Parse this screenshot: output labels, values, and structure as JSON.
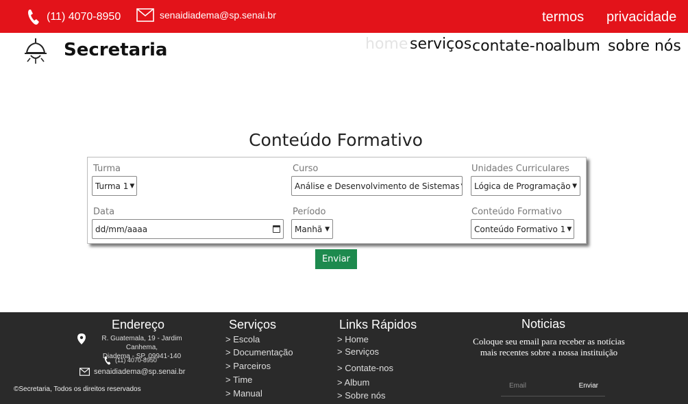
{
  "topbar": {
    "phone": "(11) 4070-8950",
    "email": "senaidiadema@sp.senai.br",
    "termos": "termos",
    "privacidade": "privacidade"
  },
  "brand": {
    "name": "Secretaria"
  },
  "nav": {
    "home": "home",
    "servicos": "serviços",
    "contate": "contate-no",
    "album": "album",
    "sobre": "sobre nós"
  },
  "form": {
    "title": "Conteúdo Formativo",
    "turma": {
      "label": "Turma",
      "value": "Turma 1"
    },
    "curso": {
      "label": "Curso",
      "value": "Análise e Desenvolvimento de Sistemas"
    },
    "uc": {
      "label": "Unidades Curriculares",
      "value": "Lógica de Programação"
    },
    "data": {
      "label": "Data",
      "value": "dd/mm/aaaa"
    },
    "periodo": {
      "label": "Período",
      "value": "Manhã"
    },
    "conteudo": {
      "label": "Conteúdo Formativo",
      "value": "Conteúdo Formativo 1"
    },
    "submit": "Enviar"
  },
  "footer": {
    "endereco": {
      "title": "Endereço",
      "address_line1": "R. Guatemala, 19 - Jardim Canhema,",
      "address_line2": "Diadema - SP, 09941-140",
      "phone": "(11) 4070-8950",
      "email": "senaidiadema@sp.senai.br"
    },
    "servicos": {
      "title": "Serviços",
      "items": [
        "> Escola",
        "> Documentação",
        "> Parceiros",
        "> Time",
        "> Manual"
      ]
    },
    "links": {
      "title": "Links Rápidos",
      "items": [
        "> Home",
        "> Serviços",
        "> Contate-nos",
        "> Album",
        "> Sobre nós"
      ]
    },
    "noticias": {
      "title": "Noticias",
      "text": "Coloque seu email para receber as notícias mais recentes sobre a nossa instituição",
      "placeholder": "Email",
      "button": "Enviar"
    },
    "copyright": "©Secretaria, Todos os direitos reservados"
  },
  "colors": {
    "topbar": "#e3131a",
    "footer": "#2a2a2a",
    "submit": "#1d8a4e"
  },
  "icons": {
    "phone": "phone-icon",
    "email": "mail-icon",
    "logo": "lamp-icon",
    "location": "location-pin-icon"
  }
}
